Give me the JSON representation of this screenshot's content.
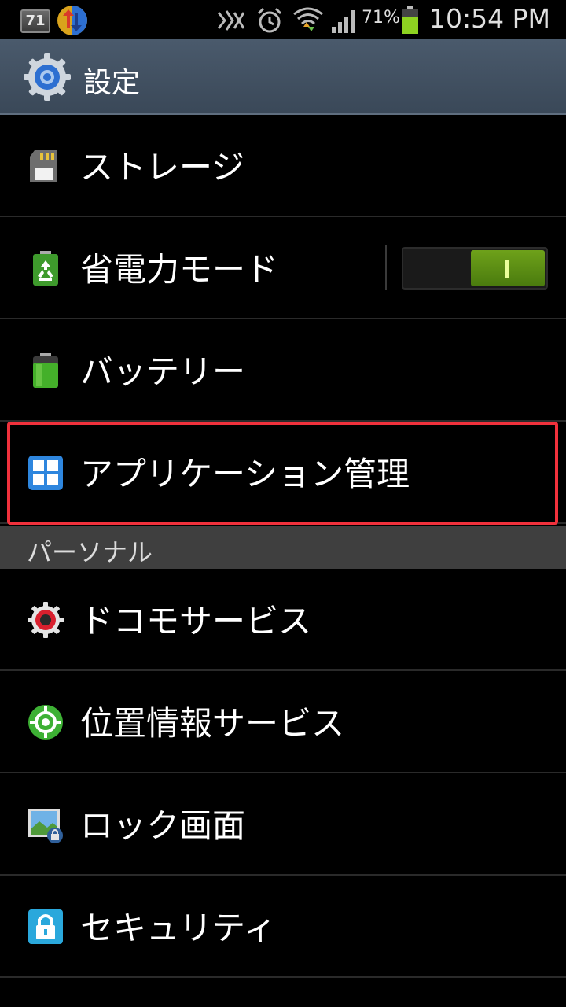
{
  "status_bar": {
    "notification_badge": "71",
    "battery_percent": "71%",
    "time": "10:54 PM",
    "battery_color": "#8ed321",
    "icons": [
      "nfc-icon",
      "alarm-icon",
      "wifi-icon",
      "signal-icon",
      "battery-icon"
    ]
  },
  "action_bar": {
    "title": "設定",
    "icon": "settings-gear-icon"
  },
  "list": {
    "storage": {
      "label": "ストレージ",
      "icon": "sd-card-icon"
    },
    "power_saving": {
      "label": "省電力モード",
      "icon": "eco-battery-icon",
      "toggle_on": true
    },
    "battery": {
      "label": "バッテリー",
      "icon": "battery-icon"
    },
    "app_manager": {
      "label": "アプリケーション管理",
      "icon": "app-grid-icon",
      "highlighted": true
    }
  },
  "section": {
    "personal": "パーソナル"
  },
  "personal_items": {
    "docomo": {
      "label": "ドコモサービス",
      "icon": "docomo-gear-icon"
    },
    "location": {
      "label": "位置情報サービス",
      "icon": "location-target-icon"
    },
    "lock_screen": {
      "label": "ロック画面",
      "icon": "lock-screen-icon"
    },
    "security": {
      "label": "セキュリティ",
      "icon": "padlock-icon"
    }
  },
  "colors": {
    "action_bar": "#44546a",
    "highlight": "#f0313c",
    "toggle_on": "#5a8c14",
    "section_header": "#3f3f3f"
  }
}
